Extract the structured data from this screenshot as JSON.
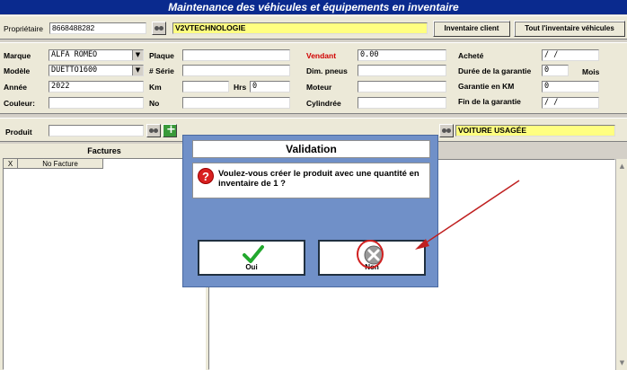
{
  "window": {
    "title": "Maintenance des véhicules et équipements en inventaire"
  },
  "owner": {
    "label": "Propriétaire",
    "code": "8668488282",
    "name": "V2VTECHNOLOGIE"
  },
  "header_buttons": {
    "client_inventory": "Inventaire client",
    "all_inventory": "Tout l'inventaire véhicules"
  },
  "vehicle": {
    "make_label": "Marque",
    "make_value": "ALFA ROMEO",
    "model_label": "Modèle",
    "model_value": "DUETTO1600",
    "year_label": "Année",
    "year_value": "2022",
    "color_label": "Couleur:",
    "color_value": "",
    "plate_label": "Plaque",
    "plate_value": "",
    "serial_label": "# Série",
    "serial_value": "",
    "km_label": "Km",
    "km_value": "",
    "hrs_label": "Hrs",
    "hrs_value": "0",
    "no_label": "No",
    "no_value": "",
    "seller_label": "Vendant",
    "seller_value": "0.00",
    "tire_label": "Dim. pneus",
    "tire_value": "",
    "engine_label": "Moteur",
    "engine_value": "",
    "cyl_label": "Cylindrée",
    "cyl_value": "",
    "bought_label": "Acheté",
    "bought_value": "/ /",
    "warranty_label": "Durée de la garantie",
    "warranty_value": "0",
    "warranty_unit": "Mois",
    "warranty_km_label": "Garantie en KM",
    "warranty_km_value": "0",
    "warranty_end_label": "Fin de la garantie",
    "warranty_end_value": "/ /"
  },
  "product": {
    "label": "Produit",
    "value": "",
    "status": "VOITURE USAGÉE"
  },
  "invoices": {
    "title": "Factures",
    "col_x": "X",
    "col_no": "No Facture"
  },
  "dialog": {
    "title": "Validation",
    "message": "Voulez-vous créer le produit avec une quantité en inventaire de 1 ?",
    "yes_label": "Oui",
    "no_label": "Non"
  },
  "colors": {
    "title_bg": "#0a2a8e",
    "dialog_bg": "#7090c8",
    "highlight": "#ffff80",
    "annotation": "#d02020"
  }
}
